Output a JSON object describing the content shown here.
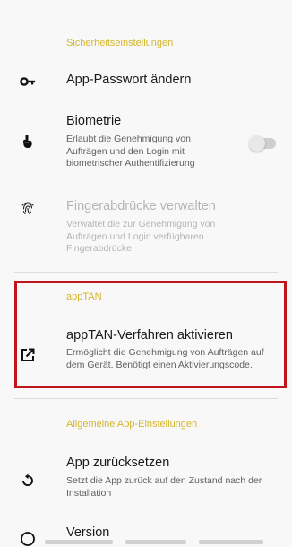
{
  "sections": {
    "security": {
      "title": "Sicherheitseinstellungen"
    },
    "apptan": {
      "title": "appTAN"
    },
    "general": {
      "title": "Allgemeine App-Einstellungen"
    }
  },
  "rows": {
    "app_password": {
      "title": "App-Passwort ändern",
      "icon": "key-icon"
    },
    "biometrics": {
      "title": "Biometrie",
      "desc": "Erlaubt die Genehmigung von Aufträgen und den Login mit biometrischer Authentifizierung",
      "icon": "touch-icon",
      "toggle_on": false
    },
    "fingerprints": {
      "title": "Fingerabdrücke verwalten",
      "desc": "Verwaltet die zur Genehmigung von Aufträgen und Login verfügbaren Fingerabdrücke",
      "icon": "fingerprint-icon"
    },
    "apptan_activate": {
      "title": "appTAN-Verfahren aktivieren",
      "desc": "Ermöglicht die Genehmigung von Aufträgen auf dem Gerät. Benötigt einen Aktivierungscode.",
      "icon": "external-link-icon"
    },
    "reset": {
      "title": "App zurücksetzen",
      "desc": "Setzt die App zurück auf den Zustand nach der Installation",
      "icon": "reset-icon"
    },
    "version": {
      "title": "Version",
      "icon": "info-icon"
    }
  },
  "colors": {
    "section_accent": "#d4b62a",
    "highlight_border": "#c0141c"
  }
}
